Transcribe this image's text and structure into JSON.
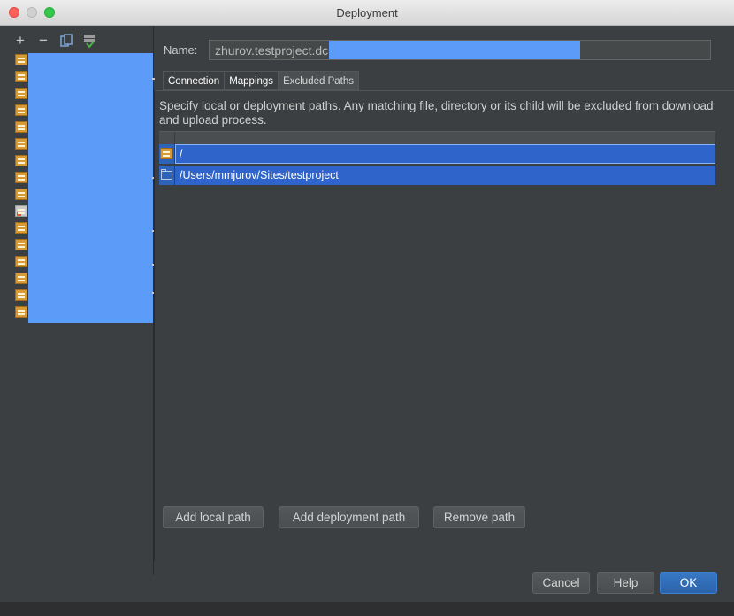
{
  "window": {
    "title": "Deployment"
  },
  "toolbar": {
    "add": "+",
    "remove": "−"
  },
  "name_field": {
    "label": "Name:",
    "value": "zhurov.testproject.dc"
  },
  "tabs": [
    {
      "label": "Connection",
      "active": false
    },
    {
      "label": "Mappings",
      "active": false
    },
    {
      "label": "Excluded Paths",
      "active": true
    }
  ],
  "excluded_paths": {
    "description": "Specify local or deployment paths. Any matching file, directory or its child will be excluded from download and upload process.",
    "rows": [
      {
        "path": "/",
        "icon": "server-icon"
      },
      {
        "path": "/Users/mmjurov/Sites/testproject",
        "icon": "folder-icon"
      }
    ]
  },
  "buttons": {
    "add_local": "Add local path",
    "add_deployment": "Add deployment path",
    "remove": "Remove path",
    "cancel": "Cancel",
    "help": "Help",
    "ok": "OK"
  },
  "colors": {
    "background": "#3c3f41",
    "selection": "#2f65ca",
    "redaction": "#5c9cf8",
    "primary_button": "#2a63ab"
  }
}
